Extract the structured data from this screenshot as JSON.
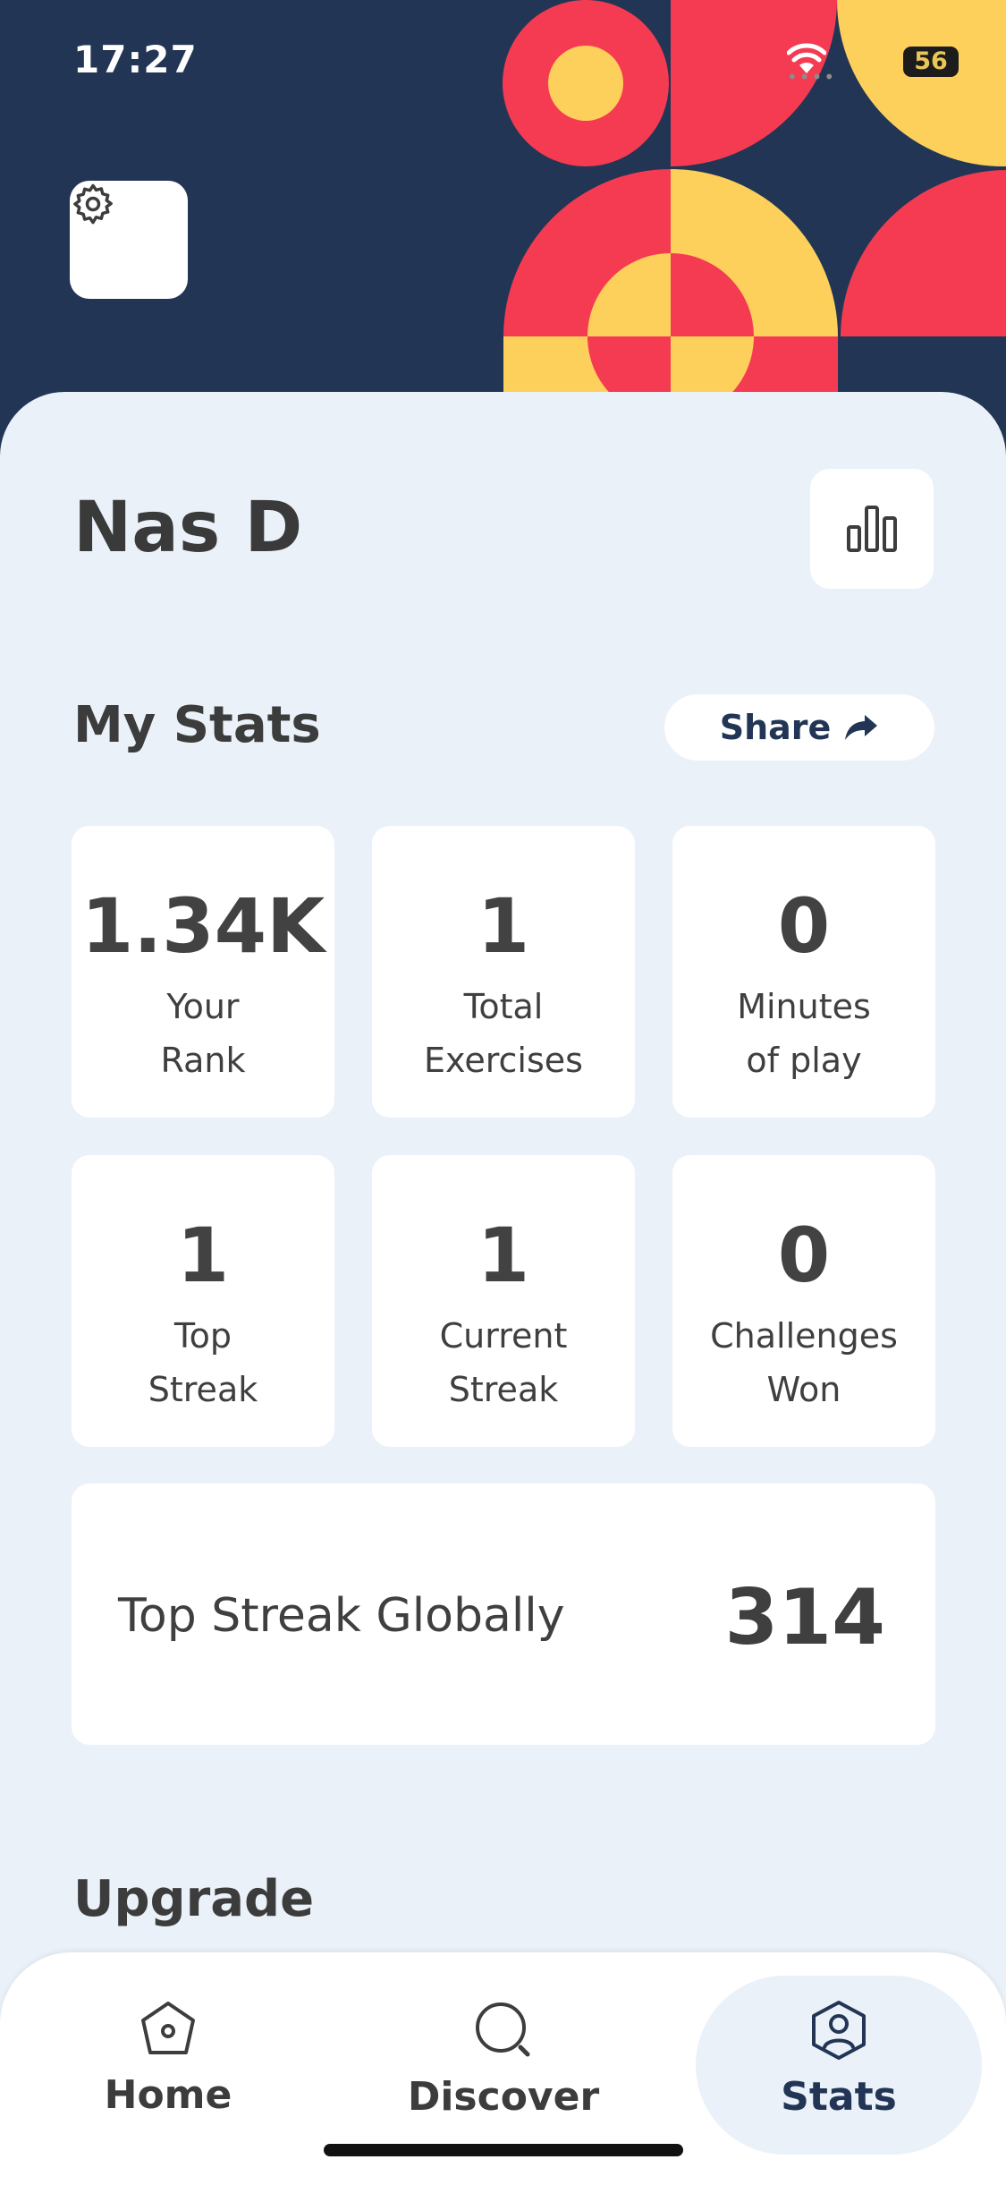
{
  "status_bar": {
    "time": "17:27",
    "battery": "56"
  },
  "profile": {
    "name": "Nas D"
  },
  "stats_section": {
    "title": "My Stats",
    "share_label": "Share"
  },
  "stats": [
    {
      "value": "1.34K",
      "label": "Your\nRank"
    },
    {
      "value": "1",
      "label": "Total\nExercises"
    },
    {
      "value": "0",
      "label": "Minutes\nof play"
    },
    {
      "value": "1",
      "label": "Top\nStreak"
    },
    {
      "value": "1",
      "label": "Current\nStreak"
    },
    {
      "value": "0",
      "label": "Challenges\nWon"
    }
  ],
  "global_streak": {
    "label": "Top Streak Globally",
    "value": "314"
  },
  "upgrade": {
    "title": "Upgrade"
  },
  "tabs": [
    {
      "label": "Home",
      "icon": "home-icon"
    },
    {
      "label": "Discover",
      "icon": "search-icon"
    },
    {
      "label": "Stats",
      "icon": "profile-icon",
      "active": true
    }
  ],
  "colors": {
    "navy": "#223555",
    "red": "#f53b51",
    "yellow": "#fdd05c",
    "background": "#eaf1f8"
  }
}
